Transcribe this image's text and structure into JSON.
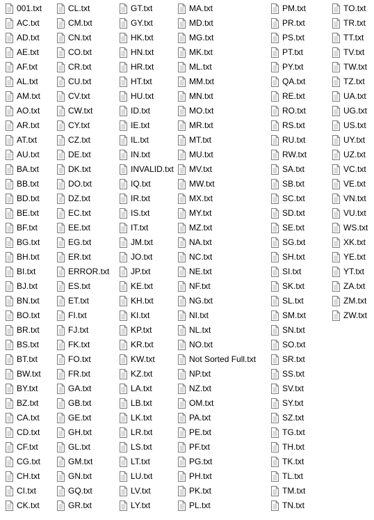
{
  "icon": "text-file-icon",
  "columns": [
    {
      "files": [
        "001.txt",
        "AC.txt",
        "AD.txt",
        "AE.txt",
        "AF.txt",
        "AL.txt",
        "AM.txt",
        "AO.txt",
        "AR.txt",
        "AT.txt",
        "AU.txt",
        "BA.txt",
        "BB.txt",
        "BD.txt",
        "BE.txt",
        "BF.txt",
        "BG.txt",
        "BH.txt",
        "BI.txt",
        "BJ.txt",
        "BN.txt",
        "BO.txt",
        "BR.txt",
        "BS.txt",
        "BT.txt",
        "BW.txt",
        "BY.txt",
        "BZ.txt",
        "CA.txt",
        "CD.txt",
        "CF.txt",
        "CG.txt",
        "CH.txt",
        "CI.txt",
        "CK.txt"
      ]
    },
    {
      "files": [
        "CL.txt",
        "CM.txt",
        "CN.txt",
        "CO.txt",
        "CR.txt",
        "CU.txt",
        "CV.txt",
        "CW.txt",
        "CY.txt",
        "CZ.txt",
        "DE.txt",
        "DK.txt",
        "DO.txt",
        "DZ.txt",
        "EC.txt",
        "EE.txt",
        "EG.txt",
        "ER.txt",
        "ERROR.txt",
        "ES.txt",
        "ET.txt",
        "FI.txt",
        "FJ.txt",
        "FK.txt",
        "FO.txt",
        "FR.txt",
        "GA.txt",
        "GB.txt",
        "GE.txt",
        "GH.txt",
        "GL.txt",
        "GM.txt",
        "GN.txt",
        "GQ.txt",
        "GR.txt"
      ]
    },
    {
      "files": [
        "GT.txt",
        "GY.txt",
        "HK.txt",
        "HN.txt",
        "HR.txt",
        "HT.txt",
        "HU.txt",
        "ID.txt",
        "IE.txt",
        "IL.txt",
        "IN.txt",
        "INVALID.txt",
        "IQ.txt",
        "IR.txt",
        "IS.txt",
        "IT.txt",
        "JM.txt",
        "JO.txt",
        "JP.txt",
        "KE.txt",
        "KH.txt",
        "KI.txt",
        "KP.txt",
        "KR.txt",
        "KW.txt",
        "KZ.txt",
        "LA.txt",
        "LB.txt",
        "LK.txt",
        "LR.txt",
        "LS.txt",
        "LT.txt",
        "LU.txt",
        "LV.txt",
        "LY.txt"
      ]
    },
    {
      "files": [
        "MA.txt",
        "MD.txt",
        "MG.txt",
        "MK.txt",
        "ML.txt",
        "MM.txt",
        "MN.txt",
        "MO.txt",
        "MR.txt",
        "MT.txt",
        "MU.txt",
        "MV.txt",
        "MW.txt",
        "MX.txt",
        "MY.txt",
        "MZ.txt",
        "NA.txt",
        "NC.txt",
        "NE.txt",
        "NF.txt",
        "NG.txt",
        "NI.txt",
        "NL.txt",
        "NO.txt",
        "Not Sorted Full.txt",
        "NP.txt",
        "NZ.txt",
        "OM.txt",
        "PA.txt",
        "PE.txt",
        "PF.txt",
        "PG.txt",
        "PH.txt",
        "PK.txt",
        "PL.txt"
      ]
    },
    {
      "files": [
        "PM.txt",
        "PR.txt",
        "PS.txt",
        "PT.txt",
        "PY.txt",
        "QA.txt",
        "RE.txt",
        "RO.txt",
        "RS.txt",
        "RU.txt",
        "RW.txt",
        "SA.txt",
        "SB.txt",
        "SC.txt",
        "SD.txt",
        "SE.txt",
        "SG.txt",
        "SH.txt",
        "SI.txt",
        "SK.txt",
        "SL.txt",
        "SM.txt",
        "SN.txt",
        "SO.txt",
        "SR.txt",
        "SS.txt",
        "SV.txt",
        "SY.txt",
        "SZ.txt",
        "TG.txt",
        "TH.txt",
        "TK.txt",
        "TL.txt",
        "TM.txt",
        "TN.txt"
      ]
    },
    {
      "files": [
        "TO.txt",
        "TR.txt",
        "TT.txt",
        "TV.txt",
        "TW.txt",
        "TZ.txt",
        "UA.txt",
        "UG.txt",
        "US.txt",
        "UY.txt",
        "UZ.txt",
        "VC.txt",
        "VE.txt",
        "VN.txt",
        "VU.txt",
        "WS.txt",
        "XK.txt",
        "YE.txt",
        "YT.txt",
        "ZA.txt",
        "ZM.txt",
        "ZW.txt"
      ]
    }
  ]
}
